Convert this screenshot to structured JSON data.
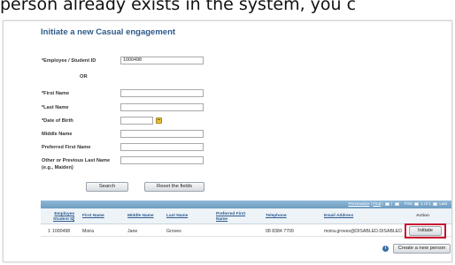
{
  "caption": "person already exists in the system, you c",
  "panel": {
    "title": "Initiate a new Casual engagement"
  },
  "form": {
    "employee_id_label": "*Employee / Student ID",
    "employee_id_value": "1000498",
    "or_label": "OR",
    "first_name_label": "*First Name",
    "last_name_label": "*Last Name",
    "dob_label": "*Date of Birth",
    "middle_name_label": "Middle Name",
    "preferred_first_label": "Preferred First Name",
    "other_last_label_1": "Other or Previous Last Name",
    "other_last_label_2": "(e.g., Maiden)"
  },
  "buttons": {
    "search": "Search",
    "reset": "Reset the fields",
    "initiate": "Initiate",
    "create": "Create a new person"
  },
  "grid": {
    "personalize": "Personalize",
    "find": "Find",
    "first": "First",
    "range": "1 of 1",
    "last": "Last",
    "headers": {
      "emp_id_1": "Employee /",
      "emp_id_2": "Student ID",
      "first_name": "First Name",
      "middle_name": "Middle Name",
      "last_name": "Last Name",
      "pref_first_1": "Preferred First",
      "pref_first_2": "Name",
      "telephone": "Telephone",
      "email": "Email Address",
      "action": "Action"
    },
    "row": {
      "num": "1",
      "emp_id": "1000498",
      "first_name": "Moira",
      "middle_name": "Jane",
      "last_name": "Groves",
      "preferred_first": "",
      "telephone": "08 8384 7709",
      "email": "moira.groves@DISABLED.DISABLED"
    }
  },
  "colors": {
    "title_blue": "#2d5a8c",
    "grid_bar": "#7fa9cc",
    "highlight_red": "#c8102e"
  }
}
